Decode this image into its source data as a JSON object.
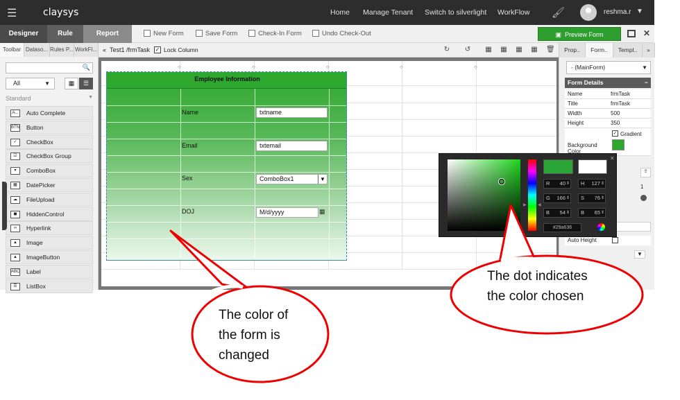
{
  "topbar": {
    "logo": "claysys",
    "nav": [
      "Home",
      "Manage Tenant",
      "Switch to silverlight",
      "WorkFlow"
    ],
    "user": "reshma.r"
  },
  "modes": {
    "designer": "Designer",
    "rule": "Rule",
    "report": "Report"
  },
  "toolbar": {
    "new_form": "New Form",
    "save_form": "Save Form",
    "check_in": "Check-In Form",
    "undo_checkout": "Undo Check-Out",
    "preview": "Preview Form"
  },
  "left_panel": {
    "tabs": [
      "Toolbar",
      "Dataso...",
      "Rules P...",
      "WorkFl..."
    ],
    "filter": "All",
    "section": "Standard",
    "items": [
      {
        "label": "Auto Complete",
        "icon": "A..."
      },
      {
        "label": "Button",
        "icon": "BTN"
      },
      {
        "label": "CheckBox",
        "icon": "✓"
      },
      {
        "label": "CheckBox Group",
        "icon": "☑"
      },
      {
        "label": "ComboBox",
        "icon": "▾"
      },
      {
        "label": "DatePicker",
        "icon": "▦"
      },
      {
        "label": "FileUpload",
        "icon": "☁"
      },
      {
        "label": "HiddenControl",
        "icon": "◼"
      },
      {
        "label": "Hyperlink",
        "icon": "∞"
      },
      {
        "label": "Image",
        "icon": "▲"
      },
      {
        "label": "ImageButton",
        "icon": "▲"
      },
      {
        "label": "Label",
        "icon": "ABC"
      },
      {
        "label": "ListBox",
        "icon": "☰"
      }
    ]
  },
  "canvas": {
    "breadcrumb": "Test1 /frmTask",
    "lock_label": "Lock Column",
    "form": {
      "header": "Employee Information",
      "fields": [
        {
          "label": "Name",
          "value": "txtname"
        },
        {
          "label": "Email",
          "value": "txtemail"
        },
        {
          "label": "Sex",
          "value": "ComboBox1"
        },
        {
          "label": "DOJ",
          "value": "M/d/yyyy"
        }
      ]
    }
  },
  "right_panel": {
    "tabs": [
      "Prop..",
      "Form..",
      "Templ.."
    ],
    "selected_object": "- (MainForm)",
    "section": "Form Details",
    "properties": [
      {
        "key": "Name",
        "value": "frmTask"
      },
      {
        "key": "Title",
        "value": "frmTask"
      },
      {
        "key": "Width",
        "value": "500"
      },
      {
        "key": "Height",
        "value": "350"
      }
    ],
    "gradient_label": "Gradient",
    "background_label": "Background Color",
    "auto_height": "Auto Height",
    "value_one": "1"
  },
  "color_picker": {
    "r": "40",
    "g": "166",
    "b": "54",
    "h": "127",
    "s": "76",
    "bv": "65",
    "hex": "#29a636",
    "selected_color": "#29a636"
  },
  "callouts": {
    "form_color": "The color of the form is changed",
    "dot": "The dot indicates the color chosen"
  }
}
